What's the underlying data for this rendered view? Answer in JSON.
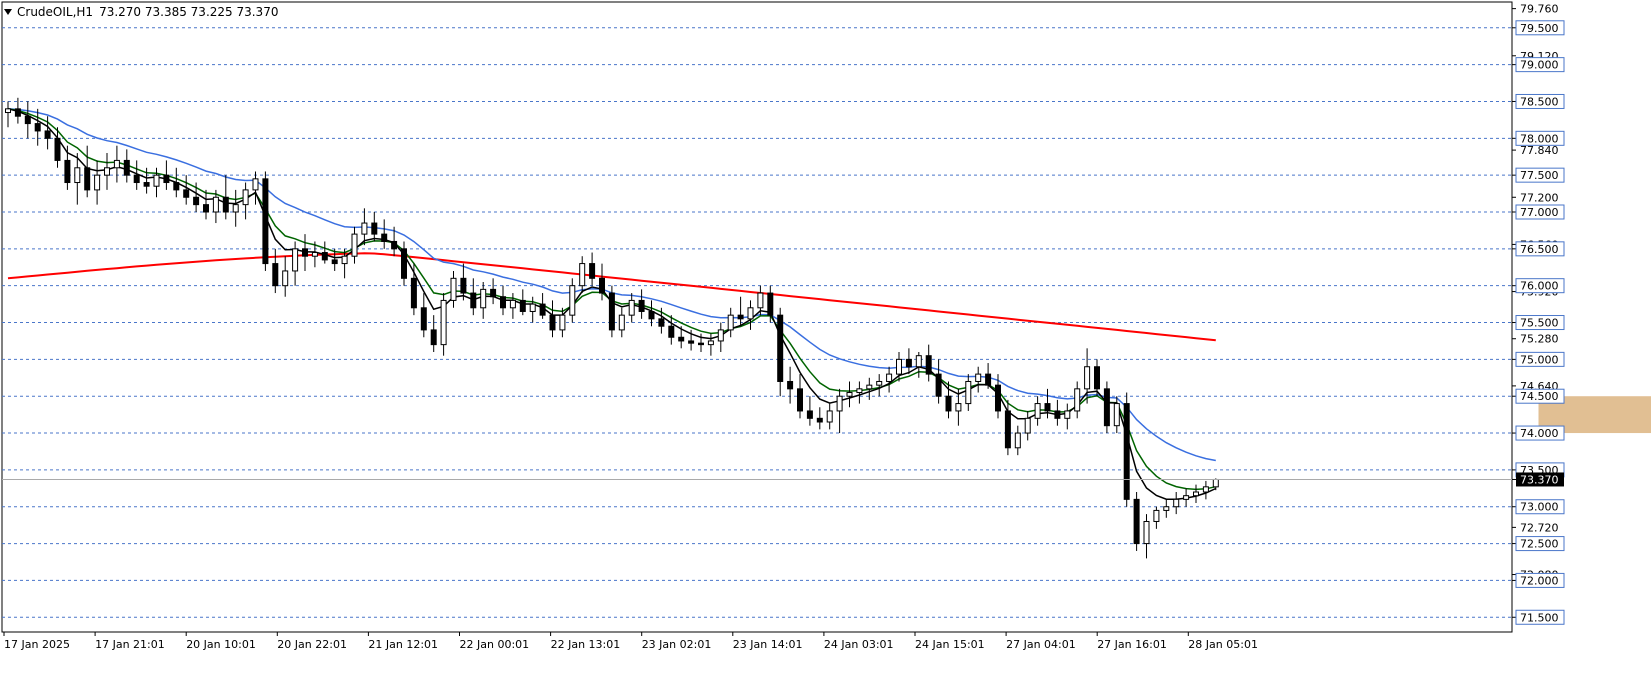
{
  "header": {
    "symbol": "CrudeOIL,H1",
    "ohlc": "73.270 73.385 73.225 73.370"
  },
  "colors": {
    "background": "#ffffff",
    "grid": "#4a76c9",
    "bull_body": "#ffffff",
    "bear_body": "#000000",
    "ema_fast": "#000000",
    "ema_mid": "#006400",
    "ema_slow": "#3a6fe0",
    "ma_long": "#ff0000",
    "zone": "#deb887",
    "current_price_bg": "#000000"
  },
  "price_axis": {
    "labels": [
      "79.760",
      "79.500",
      "79.120",
      "79.000",
      "78.500",
      "78.000",
      "77.840",
      "77.500",
      "77.200",
      "77.000",
      "76.560",
      "76.500",
      "75.920",
      "76.000",
      "75.500",
      "75.280",
      "75.000",
      "74.640",
      "74.500",
      "74.000",
      "73.500",
      "73.370",
      "73.000",
      "72.720",
      "72.500",
      "72.080",
      "72.000",
      "71.500"
    ],
    "boxed": [
      "79.500",
      "79.000",
      "78.500",
      "78.000",
      "77.500",
      "77.000",
      "76.500",
      "76.000",
      "75.500",
      "75.000",
      "74.500",
      "74.000",
      "73.500",
      "73.000",
      "72.500",
      "72.000",
      "71.500"
    ],
    "current_price": "73.370"
  },
  "time_axis": {
    "labels": [
      "17 Jan 2025",
      "17 Jan 21:01",
      "20 Jan 10:01",
      "20 Jan 22:01",
      "21 Jan 12:01",
      "22 Jan 00:01",
      "22 Jan 13:01",
      "23 Jan 02:01",
      "23 Jan 14:01",
      "24 Jan 03:01",
      "24 Jan 15:01",
      "27 Jan 04:01",
      "27 Jan 16:01",
      "28 Jan 05:01"
    ]
  },
  "chart_data": {
    "type": "candlestick",
    "symbol": "CrudeOIL",
    "timeframe": "H1",
    "ylim": [
      71.3,
      79.85
    ],
    "grid_levels": [
      79.5,
      79.0,
      78.5,
      78.0,
      77.5,
      77.0,
      76.5,
      76.0,
      75.5,
      75.0,
      74.5,
      74.0,
      73.5,
      73.0,
      72.5,
      72.0,
      71.5
    ],
    "last": {
      "open": 73.27,
      "high": 73.385,
      "low": 73.225,
      "close": 73.37
    },
    "zone": {
      "from_bar": 155,
      "to_bar": 184,
      "high": 74.5,
      "low": 74.0
    },
    "candles": [
      [
        78.35,
        78.5,
        78.15,
        78.4
      ],
      [
        78.4,
        78.55,
        78.2,
        78.3
      ],
      [
        78.3,
        78.5,
        78.0,
        78.2
      ],
      [
        78.2,
        78.4,
        77.9,
        78.1
      ],
      [
        78.1,
        78.3,
        77.85,
        78.0
      ],
      [
        78.0,
        78.15,
        77.6,
        77.7
      ],
      [
        77.7,
        77.9,
        77.3,
        77.4
      ],
      [
        77.4,
        77.8,
        77.1,
        77.6
      ],
      [
        77.6,
        77.9,
        77.2,
        77.3
      ],
      [
        77.3,
        77.7,
        77.1,
        77.5
      ],
      [
        77.5,
        77.8,
        77.3,
        77.6
      ],
      [
        77.6,
        77.9,
        77.4,
        77.7
      ],
      [
        77.7,
        77.85,
        77.4,
        77.5
      ],
      [
        77.5,
        77.7,
        77.3,
        77.4
      ],
      [
        77.4,
        77.6,
        77.25,
        77.35
      ],
      [
        77.35,
        77.6,
        77.2,
        77.5
      ],
      [
        77.5,
        77.7,
        77.3,
        77.4
      ],
      [
        77.4,
        77.6,
        77.2,
        77.3
      ],
      [
        77.3,
        77.5,
        77.1,
        77.2
      ],
      [
        77.2,
        77.4,
        77.0,
        77.1
      ],
      [
        77.1,
        77.3,
        76.9,
        77.0
      ],
      [
        77.0,
        77.3,
        76.85,
        77.2
      ],
      [
        77.2,
        77.5,
        76.9,
        77.0
      ],
      [
        77.0,
        77.3,
        76.8,
        77.1
      ],
      [
        77.1,
        77.4,
        76.9,
        77.3
      ],
      [
        77.3,
        77.55,
        77.1,
        77.45
      ],
      [
        77.45,
        77.55,
        76.2,
        76.3
      ],
      [
        76.3,
        76.5,
        75.9,
        76.0
      ],
      [
        76.0,
        76.4,
        75.85,
        76.2
      ],
      [
        76.2,
        76.6,
        76.0,
        76.5
      ],
      [
        76.5,
        76.7,
        76.2,
        76.4
      ],
      [
        76.4,
        76.6,
        76.25,
        76.45
      ],
      [
        76.45,
        76.6,
        76.3,
        76.35
      ],
      [
        76.35,
        76.5,
        76.2,
        76.3
      ],
      [
        76.3,
        76.5,
        76.1,
        76.4
      ],
      [
        76.4,
        76.8,
        76.3,
        76.7
      ],
      [
        76.7,
        77.05,
        76.55,
        76.85
      ],
      [
        76.85,
        77.0,
        76.6,
        76.7
      ],
      [
        76.7,
        76.9,
        76.5,
        76.6
      ],
      [
        76.6,
        76.8,
        76.4,
        76.5
      ],
      [
        76.5,
        76.6,
        76.0,
        76.1
      ],
      [
        76.1,
        76.3,
        75.6,
        75.7
      ],
      [
        75.7,
        75.9,
        75.3,
        75.4
      ],
      [
        75.4,
        75.6,
        75.1,
        75.2
      ],
      [
        75.2,
        75.9,
        75.05,
        75.8
      ],
      [
        75.8,
        76.2,
        75.7,
        76.1
      ],
      [
        76.1,
        76.3,
        75.8,
        75.9
      ],
      [
        75.9,
        76.1,
        75.6,
        75.7
      ],
      [
        75.7,
        76.05,
        75.55,
        75.95
      ],
      [
        75.95,
        76.1,
        75.75,
        75.85
      ],
      [
        75.85,
        76.0,
        75.6,
        75.7
      ],
      [
        75.7,
        75.9,
        75.55,
        75.8
      ],
      [
        75.8,
        75.95,
        75.6,
        75.65
      ],
      [
        75.65,
        75.85,
        75.5,
        75.75
      ],
      [
        75.75,
        75.9,
        75.55,
        75.6
      ],
      [
        75.6,
        75.8,
        75.3,
        75.4
      ],
      [
        75.4,
        75.7,
        75.3,
        75.6
      ],
      [
        75.6,
        76.1,
        75.5,
        76.0
      ],
      [
        76.0,
        76.4,
        75.9,
        76.3
      ],
      [
        76.3,
        76.45,
        76.0,
        76.1
      ],
      [
        76.1,
        76.3,
        75.8,
        75.9
      ],
      [
        75.9,
        76.0,
        75.3,
        75.4
      ],
      [
        75.4,
        75.7,
        75.3,
        75.6
      ],
      [
        75.6,
        75.9,
        75.5,
        75.8
      ],
      [
        75.8,
        75.95,
        75.55,
        75.65
      ],
      [
        75.65,
        75.8,
        75.45,
        75.55
      ],
      [
        75.55,
        75.7,
        75.35,
        75.45
      ],
      [
        75.45,
        75.6,
        75.2,
        75.3
      ],
      [
        75.3,
        75.45,
        75.15,
        75.25
      ],
      [
        75.25,
        75.4,
        75.12,
        75.22
      ],
      [
        75.22,
        75.35,
        75.1,
        75.2
      ],
      [
        75.2,
        75.35,
        75.05,
        75.25
      ],
      [
        75.25,
        75.5,
        75.1,
        75.4
      ],
      [
        75.4,
        75.7,
        75.3,
        75.6
      ],
      [
        75.6,
        75.85,
        75.45,
        75.55
      ],
      [
        75.55,
        75.8,
        75.4,
        75.7
      ],
      [
        75.7,
        76.0,
        75.6,
        75.9
      ],
      [
        75.9,
        76.0,
        75.5,
        75.6
      ],
      [
        75.6,
        75.7,
        74.5,
        74.7
      ],
      [
        74.7,
        74.9,
        74.4,
        74.6
      ],
      [
        74.6,
        74.8,
        74.2,
        74.3
      ],
      [
        74.3,
        74.5,
        74.1,
        74.2
      ],
      [
        74.2,
        74.35,
        74.05,
        74.15
      ],
      [
        74.15,
        74.4,
        74.05,
        74.3
      ],
      [
        74.3,
        74.6,
        74.0,
        74.5
      ],
      [
        74.5,
        74.7,
        74.35,
        74.55
      ],
      [
        74.55,
        74.7,
        74.4,
        74.6
      ],
      [
        74.6,
        74.75,
        74.45,
        74.65
      ],
      [
        74.65,
        74.8,
        74.5,
        74.7
      ],
      [
        74.7,
        74.9,
        74.55,
        74.8
      ],
      [
        74.8,
        75.1,
        74.7,
        75.0
      ],
      [
        75.0,
        75.15,
        74.8,
        74.9
      ],
      [
        74.9,
        75.1,
        74.75,
        75.05
      ],
      [
        75.05,
        75.2,
        74.7,
        74.8
      ],
      [
        74.8,
        75.0,
        74.4,
        74.5
      ],
      [
        74.5,
        74.7,
        74.2,
        74.3
      ],
      [
        74.3,
        74.6,
        74.1,
        74.4
      ],
      [
        74.4,
        74.8,
        74.3,
        74.7
      ],
      [
        74.7,
        74.9,
        74.55,
        74.8
      ],
      [
        74.8,
        74.95,
        74.6,
        74.65
      ],
      [
        74.65,
        74.8,
        74.2,
        74.3
      ],
      [
        74.3,
        74.45,
        73.7,
        73.8
      ],
      [
        73.8,
        74.1,
        73.7,
        74.0
      ],
      [
        74.0,
        74.3,
        73.9,
        74.2
      ],
      [
        74.2,
        74.5,
        74.1,
        74.4
      ],
      [
        74.4,
        74.6,
        74.2,
        74.3
      ],
      [
        74.3,
        74.45,
        74.1,
        74.2
      ],
      [
        74.2,
        74.4,
        74.05,
        74.3
      ],
      [
        74.3,
        74.7,
        74.2,
        74.6
      ],
      [
        74.6,
        75.15,
        74.4,
        74.9
      ],
      [
        74.9,
        75.0,
        74.5,
        74.6
      ],
      [
        74.6,
        74.7,
        74.0,
        74.1
      ],
      [
        74.1,
        74.5,
        74.0,
        74.4
      ],
      [
        74.4,
        74.55,
        73.0,
        73.1
      ],
      [
        73.1,
        73.2,
        72.4,
        72.5
      ],
      [
        72.5,
        72.9,
        72.3,
        72.8
      ],
      [
        72.8,
        73.0,
        72.7,
        72.95
      ],
      [
        72.95,
        73.1,
        72.85,
        73.0
      ],
      [
        73.0,
        73.2,
        72.9,
        73.1
      ],
      [
        73.1,
        73.25,
        73.0,
        73.15
      ],
      [
        73.15,
        73.3,
        73.05,
        73.2
      ],
      [
        73.2,
        73.35,
        73.1,
        73.27
      ],
      [
        73.27,
        73.385,
        73.225,
        73.37
      ]
    ]
  }
}
